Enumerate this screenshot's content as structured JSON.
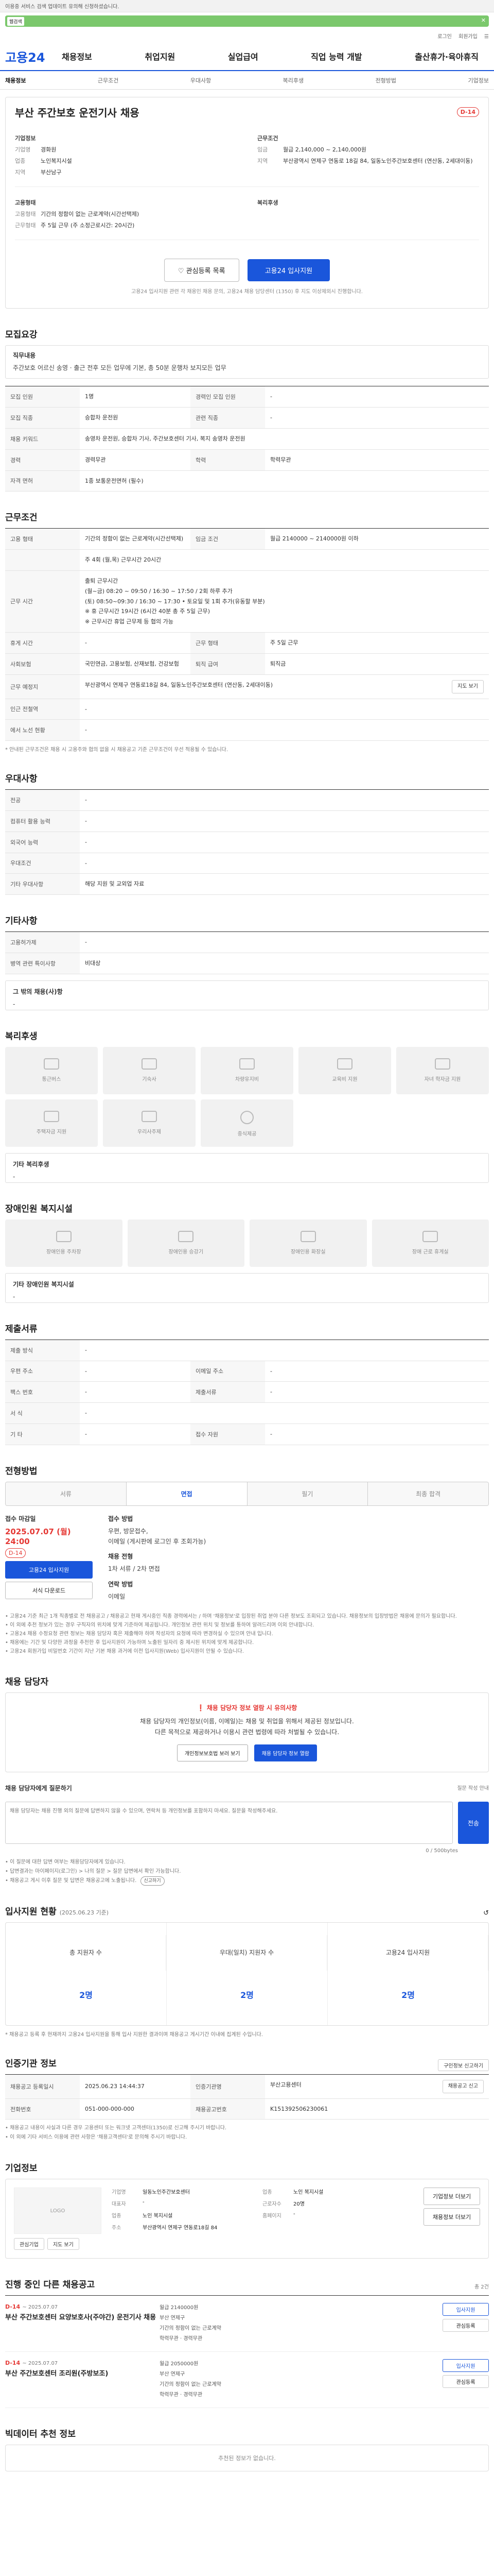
{
  "browser": {
    "top_text": "이용중 서비스 검색 업데이트 유의해 신청하셨습니다.",
    "bar_label": "웹검색",
    "close": "✕"
  },
  "util": [
    "로그인",
    "회원가입",
    "☰"
  ],
  "logo": "고용24",
  "gnb": [
    "채용정보",
    "취업지원",
    "실업급여",
    "직업 능력 개발",
    "출산휴가·육아휴직"
  ],
  "subnav": [
    "채용정보",
    "근무조건",
    "우대사항",
    "복리후생",
    "전형방법",
    "기업정보"
  ],
  "job": {
    "title": "부산 주간보호 운전기사 채용",
    "dday": "D-14",
    "company_label": "기업정보",
    "company_rows": [
      {
        "k": "기업명",
        "v": "경화원"
      },
      {
        "k": "업종",
        "v": "노인복지시설"
      },
      {
        "k": "지역",
        "v": "부산남구"
      }
    ],
    "cond_label": "근무조건",
    "cond_rows": [
      {
        "k": "임금",
        "v": "월급 2,140,000 ~ 2,140,000원"
      },
      {
        "k": "지역",
        "v": "부산광역시 연제구 연동로 18길 84, 일동노인주간보호센터 (연산동, 2세대이동)"
      }
    ],
    "form_label": "고용형태",
    "form_rows": [
      {
        "k": "고용형태",
        "v": "기간의 정함이 없는 근로계약(시간선택제)"
      },
      {
        "k": "근무형태",
        "v": "주 5일 근무 (주 소정근로시간: 20시간)"
      }
    ],
    "welfare_label": "복리후생",
    "actions": {
      "scrap": "관심등록 목록",
      "apply": "고용24 입사지원"
    },
    "notice": "고용24 입사지원 관련 각 채용인 채용 문의, 고용24 채용 담당센터 (1350) 후 지도 이상제외시 진행합니다."
  },
  "req": {
    "title": "모집요강",
    "duty_label": "직무내용",
    "duty_text": "주간보호 어르신 송영 · 출근 전후 모든 업무에 기본, 총 50분 운행차 보지모든 업무",
    "rows": [
      {
        "k": "모집 인원",
        "v": "1명",
        "k2": "경력인 모집 인원",
        "v2": "-"
      },
      {
        "k": "모집 직종",
        "v": "승합차 운전원",
        "k2": "관련 직종",
        "v2": "-"
      },
      {
        "k": "채용 키워드",
        "v": "송영차 운전원, 승합차 기사, 주간보호센터 기사, 복지 송영차 운전원",
        "k2": "",
        "v2": ""
      },
      {
        "k": "경력",
        "v": "경력무관",
        "k2": "학력",
        "v2": "학력무관"
      },
      {
        "k": "자격 면허",
        "v": "1종 보통운전면허 (필수)",
        "k2": "",
        "v2": ""
      }
    ]
  },
  "cond": {
    "title": "근무조건",
    "rows": [
      {
        "k": "고용 형태",
        "v": "기간의 정함이 없는 근로계약(시간선택제)",
        "k2": "임금 조건",
        "v2": "월급 2140000 ~ 2140000원 이하"
      },
      {
        "k": "",
        "v": "주 4회 (월,목) 근무시간 20시간",
        "k2": "",
        "v2": ""
      },
      {
        "k": "근무 시간",
        "v": "출퇴 근무시간\n(월~금) 08:20 ~ 09:50 / 16:30 ~ 17:50 / 2회 하루 추가\n(토) 08:50~09:30 / 16:30 ~ 17:30 • 토요일 및 1회 추가(유동할 부분)\n※ 휴 근무시간 19시간 (6시간 40분 총 주 5일 근무)\n※ 근무시간 휴업 근무제 등 협의 가능",
        "k2": "",
        "v2": ""
      },
      {
        "k": "휴게 시간",
        "v": "-",
        "k2": "근무 형태",
        "v2": "주 5일 근무"
      },
      {
        "k": "사회보험",
        "v": "국민연금, 고용보험, 산재보험, 건강보험",
        "k2": "퇴직 급여",
        "v2": "퇴직금"
      },
      {
        "k": "근무 예정지",
        "v": "부산광역시 연제구 연동로18길 84, 일동노인주간보호센터 (연산동, 2세대이동)",
        "k2": "",
        "v2": ""
      },
      {
        "k": "인근 전철역",
        "v": "-",
        "k2": "",
        "v2": ""
      },
      {
        "k": "에서 노선 현황",
        "v": "-",
        "k2": "",
        "v2": ""
      }
    ],
    "map_btn": "지도 보기",
    "note": "* 안내된 근무조건은 채용 시 고용주와 협의 없을 시 채용공고 기준 근무조건이 우선 적용될 수 있습니다."
  },
  "pref": {
    "title": "우대사항",
    "rows": [
      {
        "k": "전공",
        "v": "-"
      },
      {
        "k": "컴퓨터 활용 능력",
        "v": "-"
      },
      {
        "k": "외국어 능력",
        "v": "-"
      },
      {
        "k": "우대조건",
        "v": "-"
      },
      {
        "k": "기타 우대사항",
        "v": "해당 지원 및 교외업 자료"
      }
    ]
  },
  "etc": {
    "title": "기타사항",
    "rows": [
      {
        "k": "고용허가제",
        "v": "-"
      },
      {
        "k": "병역 관련 특이사항",
        "v": "비대상"
      }
    ],
    "disability_label": "그 밖의 채용(사)항",
    "disability_value": "-"
  },
  "welfare": {
    "title": "복리후생",
    "items": [
      "통근버스",
      "기숙사",
      "차량유지비",
      "교육비 지원",
      "자녀 학자금 지원",
      "주택자금 지원",
      "우리사주제",
      "중식제공"
    ],
    "other_label": "기타 복리후생",
    "other_value": "-"
  },
  "disabled": {
    "title": "장애인원 복지시설",
    "items": [
      "장애인용 주차장",
      "장애인용 승강기",
      "장애인용 화장실",
      "장애 근로 휴게실"
    ],
    "other_label": "기타 장애인원 복지시설",
    "other_value": "-"
  },
  "contact": {
    "title": "제출서류",
    "rows": [
      {
        "k": "제출 방식",
        "v": "-",
        "k2": "",
        "v2": ""
      },
      {
        "k": "우편 주소",
        "v": "-",
        "k2": "이메일 주소",
        "v2": "-"
      },
      {
        "k": "팩스 번호",
        "v": "-",
        "k2": "제출서류",
        "v2": "-"
      },
      {
        "k": "서 식",
        "v": "-",
        "k2": "",
        "v2": ""
      },
      {
        "k": "기 타",
        "v": "-",
        "k2": "접수 자원",
        "v2": "-"
      }
    ]
  },
  "process": {
    "title": "전형방법",
    "tabs": [
      "서류",
      "면접",
      "필기",
      "최종 합격"
    ],
    "active": 1,
    "deadline_label": "접수 마감일",
    "deadline": "2025.07.07 (월) 24:00",
    "dday": "D-14",
    "btn_apply": "고용24 입사지원",
    "btn_print": "서식 다운로드",
    "method_label": "접수 방법",
    "method_value": "우편, 방문접수,\n이메일 (게시판에 로그인 후 조회가능)",
    "announce_label": "채용 전형",
    "announce_value": "1차 서류 / 2차 면접",
    "result_label": "연락 방법",
    "result_value": "이메일",
    "notes": [
      "• 고용24 기준 최근 1개 직종별로 전 채용공고 / 채용공고 현재 게시중인 직종 경력에서는 / 하며 '채용정보'로 입장된 취업 분야 다른 정보도 조회되고 있습니다. 채용정보의 입장방법은 채용에 문의가 필요합니다.",
      "• 이 외에 추천 정보가 있는 경우 구직자의 위치에 맞게 기준하여 제공됩니다. 개인정보 관련 위치 및 정보를 통하여 알려드리며 이외 안내합니다.",
      "• 고용24 채용 수정요청 관련 정보는 채용 담당자 혹은 제출해야 하며 작성자의 요청에 따라 변경하실 수 있으며 안내 입니다.",
      "• 채용에는 기간 및 다양한 과정을 추천한 후 입사지원이 가능하며 노출된 일자리 중 제시된 위치에 맞게 제공합니다.",
      "• 고용24 회원가입 비밀번호 기간이 지난 기본 채용 과거에 이전 입사지원(Web) 입사지원이 안될 수 있습니다."
    ]
  },
  "manager": {
    "title": "채용 담당자",
    "warn": "채용 담당자 정보 열람 시 유의사항",
    "desc1": "채용 담당자의 개인정보(이름, 이메일)는 채용 및 취업을 위해서 제공된 정보입니다.",
    "desc2": "다른 목적으로 제공하거나 이용시 관련 법령에 따라 처벌될 수 있습니다.",
    "btn1": "개인정보보호법 보러 보기",
    "btn2": "채용 담당자 정보 열람",
    "qna_label": "채용 담당자에게 질문하기",
    "qna_sub": "질문 작성 안내",
    "qna_placeholder": "채용 담당자는 채용 진행 외의 질문에 답변하지 않을 수 있으며, 연락처 등 개인정보를 포함하지 마세요. 질문을 작성해주세요.",
    "qna_count": "0 / 500bytes",
    "send": "전송",
    "notes": [
      "• 이 질문에 대한 답변 여부는 채용담당자에게 있습니다.",
      "• 답변결과는 마이페이지(로그인) > 나의 질문 > 질문 답변에서 확인 가능합니다.",
      "• 채용공고 게시 이후 질문 및 답변은 채용공고에 노출됩니다."
    ],
    "report": "신고하기"
  },
  "status": {
    "title": "입사지원 현황",
    "update": "(2025.06.23 기준)",
    "refresh": "↺",
    "items": [
      {
        "label": "총 지원자 수",
        "value": "2명"
      },
      {
        "label": "우대(일치) 지원자 수",
        "value": "2명"
      },
      {
        "label": "고용24 입사지원",
        "value": "2명"
      }
    ],
    "note": "* 채용공고 등록 후 현재까지 고용24 입사지원을 통해 입사 지원한 결과이며 채용공고 게시기간 이내에 집계된 수입니다."
  },
  "info": {
    "title": "인증기관 정보",
    "btn": "구인정보 신고하기",
    "rows": [
      {
        "k": "채용공고 등록일시",
        "v": "2025.06.23 14:44:37",
        "k2": "인증기관명",
        "v2": "부산고용센터"
      },
      {
        "k": "전화번호",
        "v": "051-000-000-000",
        "k2": "채용공고번호",
        "v2": "K151392506230061"
      }
    ],
    "report_btn": "채용공고 신고",
    "notes": [
      "• 채용공고 내용이 사실과 다른 경우 고용센터 또는 워크넷 고객센터(1350)로 신고해 주시기 바랍니다.",
      "• 이 외에 기타 서비스 이용에 관련 사항은 '채용고객센터'로 문의해 주시기 바랍니다."
    ]
  },
  "company": {
    "title": "기업정보",
    "logo_text": "LOGO",
    "btn_scrap": "관심기업",
    "btn_map": "지도 보기",
    "rows": [
      {
        "k": "기업명",
        "v": "일동노인주간보호센터",
        "k2": "업종",
        "v2": "노인 복지시설"
      },
      {
        "k": "대표자",
        "v": "-",
        "k2": "근로자수",
        "v2": "20명"
      },
      {
        "k": "업종",
        "v": "노인 복지시설",
        "k2": "홈페이지",
        "v2": "-"
      },
      {
        "k": "주소",
        "v": "부산광역시 연제구 연동로18길 84",
        "k2": "",
        "v2": ""
      }
    ],
    "btn_company": "기업정보 더보기",
    "btn_jobs": "채용정보 더보기"
  },
  "related": {
    "title": "진행 중인 다른 채용공고",
    "count": "총 2건",
    "items": [
      {
        "tag": "D-14",
        "date": "~ 2025.07.07",
        "title": "부산 주간보호센터 요양보호사(주야간) 운전기사 채용",
        "wage": "월급 2140000원",
        "place": "부산 연제구",
        "type": "기간의 정함이 없는 근로계약",
        "edu": "학력무관",
        "career": "경력무관"
      },
      {
        "tag": "D-14",
        "date": "~ 2025.07.07",
        "title": "부산 주간보호센터 조리원(주방보조)",
        "wage": "월급 2050000원",
        "place": "부산 연제구",
        "type": "기간의 정함이 없는 근로계약",
        "edu": "학력무관",
        "career": "경력무관"
      }
    ],
    "btn_apply": "입사지원",
    "btn_scrap": "관심등록"
  },
  "recommend": {
    "title": "빅데이터 추천 정보",
    "empty": "추천된 정보가 없습니다."
  }
}
